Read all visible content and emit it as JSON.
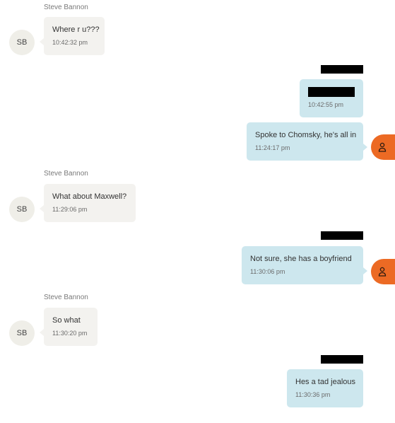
{
  "contact": {
    "name": "Steve Bannon",
    "initials": "SB"
  },
  "colors": {
    "incoming_bubble": "#f3f2ef",
    "outgoing_bubble": "#cde7ee",
    "self_avatar": "#ec6a24",
    "contact_avatar": "#efeee8"
  },
  "icons": {
    "self_avatar": "user-icon"
  },
  "messages": [
    {
      "direction": "in",
      "sender": "Steve Bannon",
      "text": "Where r u???",
      "time": "10:42:32 pm"
    },
    {
      "direction": "out",
      "sender": "[redacted]",
      "text": "[redacted]",
      "time": "10:42:55 pm"
    },
    {
      "direction": "out",
      "text": "Spoke to Chomsky, he's all in",
      "time": "11:24:17 pm"
    },
    {
      "direction": "in",
      "sender": "Steve Bannon",
      "text": "What about Maxwell?",
      "time": "11:29:06 pm"
    },
    {
      "direction": "out",
      "sender": "[redacted]",
      "text": "Not sure,  she has a boyfriend",
      "time": "11:30:06 pm"
    },
    {
      "direction": "in",
      "sender": "Steve Bannon",
      "text": "So what",
      "time": "11:30:20 pm"
    },
    {
      "direction": "out",
      "sender": "[redacted]",
      "text": "Hes a tad jealous",
      "time": "11:30:36 pm"
    }
  ]
}
